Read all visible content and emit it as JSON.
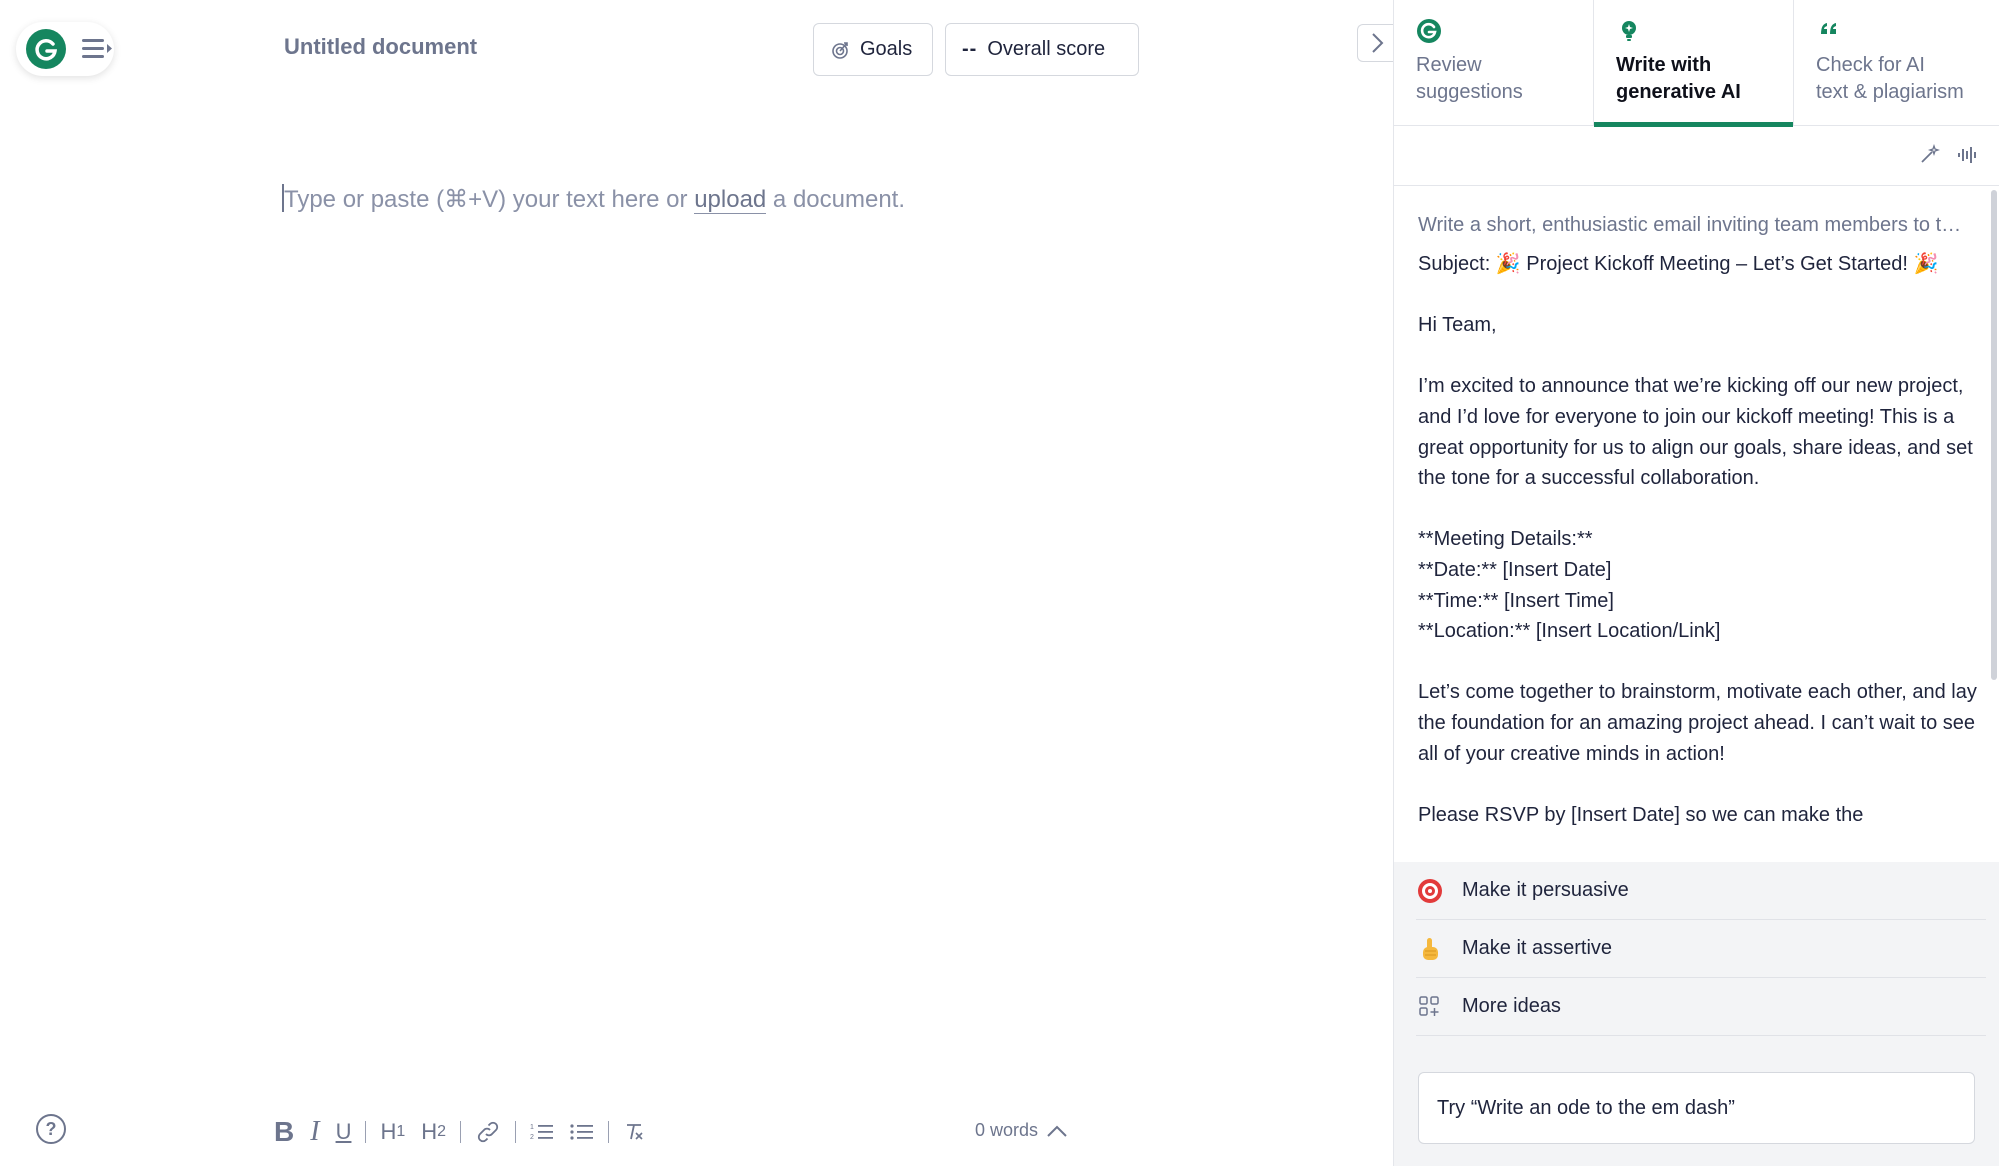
{
  "header": {
    "doc_title": "Untitled document",
    "goals_label": "Goals",
    "score_value": "--",
    "score_label": "Overall score"
  },
  "editor": {
    "placeholder_before": "Type or paste (⌘+V) your text here or ",
    "placeholder_link": "upload",
    "placeholder_after": " a document."
  },
  "footer": {
    "word_count": "0 words"
  },
  "panel": {
    "tabs": [
      {
        "label": "Review\nsuggestions",
        "icon": "grammarly-g-icon"
      },
      {
        "label": "Write with\ngenerative AI",
        "icon": "bulb-icon",
        "active": true
      },
      {
        "label": "Check for AI\ntext & plagiarism",
        "icon": "quote-icon"
      }
    ],
    "prompt": "Write a short, enthusiastic email inviting team members to the project kickoff meeting",
    "email": {
      "subject": "Subject: 🎉 Project Kickoff Meeting – Let’s Get Started! 🎉",
      "greeting": "Hi Team,",
      "p1": "I’m excited to announce that we’re kicking off our new project, and I’d love for everyone to join our kickoff meeting! This is a great opportunity for us to align our goals, share ideas, and set the tone for a successful collaboration.",
      "details_title": "**Meeting Details:**",
      "details_date": "**Date:** [Insert Date]",
      "details_time": "**Time:** [Insert Time]",
      "details_location": "**Location:** [Insert Location/Link]",
      "p2": "Let’s come together to brainstorm, motivate each other, and lay the foundation for an amazing project ahead. I can’t wait to see all of your creative minds in action!",
      "p3": "Please RSVP by [Insert Date] so we can make the"
    },
    "suggestions": [
      {
        "label": "Make it persuasive",
        "icon": "target-icon"
      },
      {
        "label": "Make it assertive",
        "icon": "pointing-finger-icon"
      },
      {
        "label": "More ideas",
        "icon": "grid-sparkle-icon"
      }
    ],
    "input_placeholder": "Try “Write an ode to the em dash”"
  },
  "colors": {
    "brand": "#15865f",
    "muted_text": "#6d758d",
    "panel_bg": "#f3f4f6"
  }
}
